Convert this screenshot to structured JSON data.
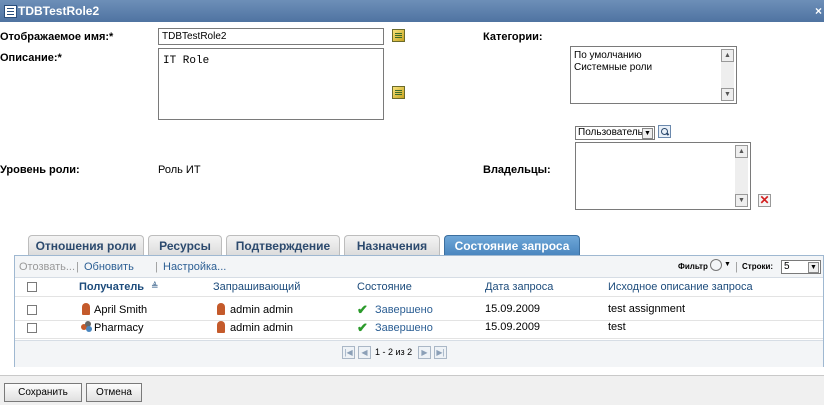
{
  "window": {
    "title": "TDBTestRole2",
    "close_glyph": "×"
  },
  "form": {
    "display_name_label": "Отображаемое имя:*",
    "display_name_value": "TDBTestRole2",
    "description_label": "Описание:*",
    "description_value": "IT Role",
    "categories_label": "Категории:",
    "categories": [
      "По умолчанию",
      "Системные роли"
    ],
    "role_level_label": "Уровень роли:",
    "role_level_value": "Роль ИТ",
    "owners_label": "Владельцы:",
    "owner_type_value": "Пользователь"
  },
  "tabs": [
    {
      "label": "Отношения роли",
      "active": false
    },
    {
      "label": "Ресурсы",
      "active": false
    },
    {
      "label": "Подтверждение",
      "active": false
    },
    {
      "label": "Назначения",
      "active": false
    },
    {
      "label": "Состояние запроса",
      "active": true
    }
  ],
  "toolbar": {
    "revoke": "Отозвать...",
    "separator": "|",
    "refresh": "Обновить",
    "settings": "Настройка...",
    "filter": "Фильтр",
    "rows_label": "Строки:",
    "rows_value": "5"
  },
  "table": {
    "sort_glyph": "≜",
    "columns": [
      "Получатель",
      "Запрашивающий",
      "Состояние",
      "Дата запроса",
      "Исходное описание запроса"
    ],
    "rows": [
      {
        "recipient": "April Smith",
        "recipient_icon": "user-icon",
        "requester": "admin admin",
        "status": "Завершено",
        "date": "15.09.2009",
        "description": "test assignment"
      },
      {
        "recipient": "Pharmacy",
        "recipient_icon": "group-icon",
        "requester": "admin admin",
        "status": "Завершено",
        "date": "15.09.2009",
        "description": "test"
      }
    ],
    "pager": "1 - 2 из 2"
  },
  "footer": {
    "save": "Сохранить",
    "cancel": "Отмена"
  },
  "colors": {
    "titlebar": "#5a7dab",
    "active_tab": "#4a86bf",
    "link": "#2c5f94",
    "remove": "#d21f1f"
  }
}
